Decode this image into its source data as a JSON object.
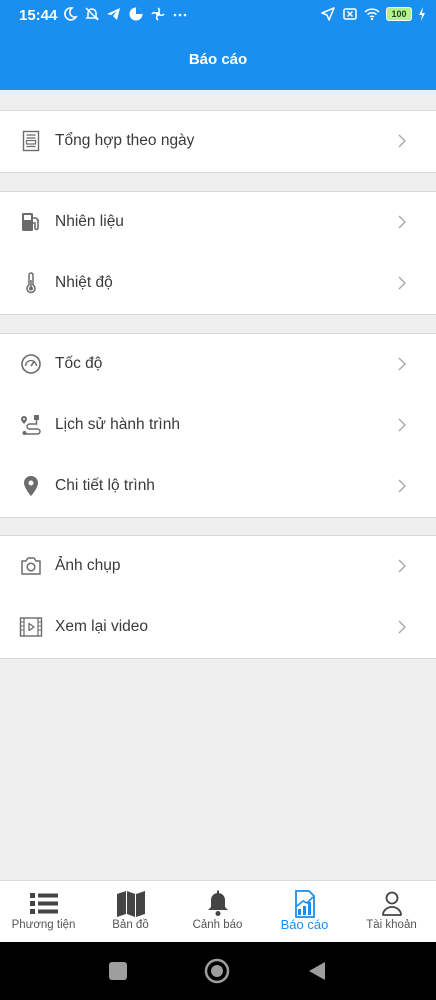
{
  "status_bar": {
    "time": "15:44",
    "battery": "100"
  },
  "header": {
    "title": "Báo cáo"
  },
  "groups": [
    {
      "items": [
        {
          "label": "Tổng hợp theo ngày",
          "icon": "document-icon"
        }
      ]
    },
    {
      "items": [
        {
          "label": "Nhiên liệu",
          "icon": "fuel-icon"
        },
        {
          "label": "Nhiệt độ",
          "icon": "thermometer-icon"
        }
      ]
    },
    {
      "items": [
        {
          "label": "Tốc độ",
          "icon": "speedometer-icon"
        },
        {
          "label": "Lịch sử hành trình",
          "icon": "route-icon"
        },
        {
          "label": "Chi tiết lộ trình",
          "icon": "location-pin-icon"
        }
      ]
    },
    {
      "items": [
        {
          "label": "Ảnh chụp",
          "icon": "camera-icon"
        },
        {
          "label": "Xem lại video",
          "icon": "video-icon"
        }
      ]
    }
  ],
  "tabs": [
    {
      "label": "Phương tiện",
      "icon": "list-icon"
    },
    {
      "label": "Bản đồ",
      "icon": "map-icon"
    },
    {
      "label": "Cảnh báo",
      "icon": "bell-icon"
    },
    {
      "label": "Báo cáo",
      "icon": "report-chart-icon",
      "active": true
    },
    {
      "label": "Tài khoản",
      "icon": "user-icon"
    }
  ],
  "colors": {
    "primary": "#1a8ff0",
    "background": "#efefef",
    "text": "#3a3a3a"
  }
}
